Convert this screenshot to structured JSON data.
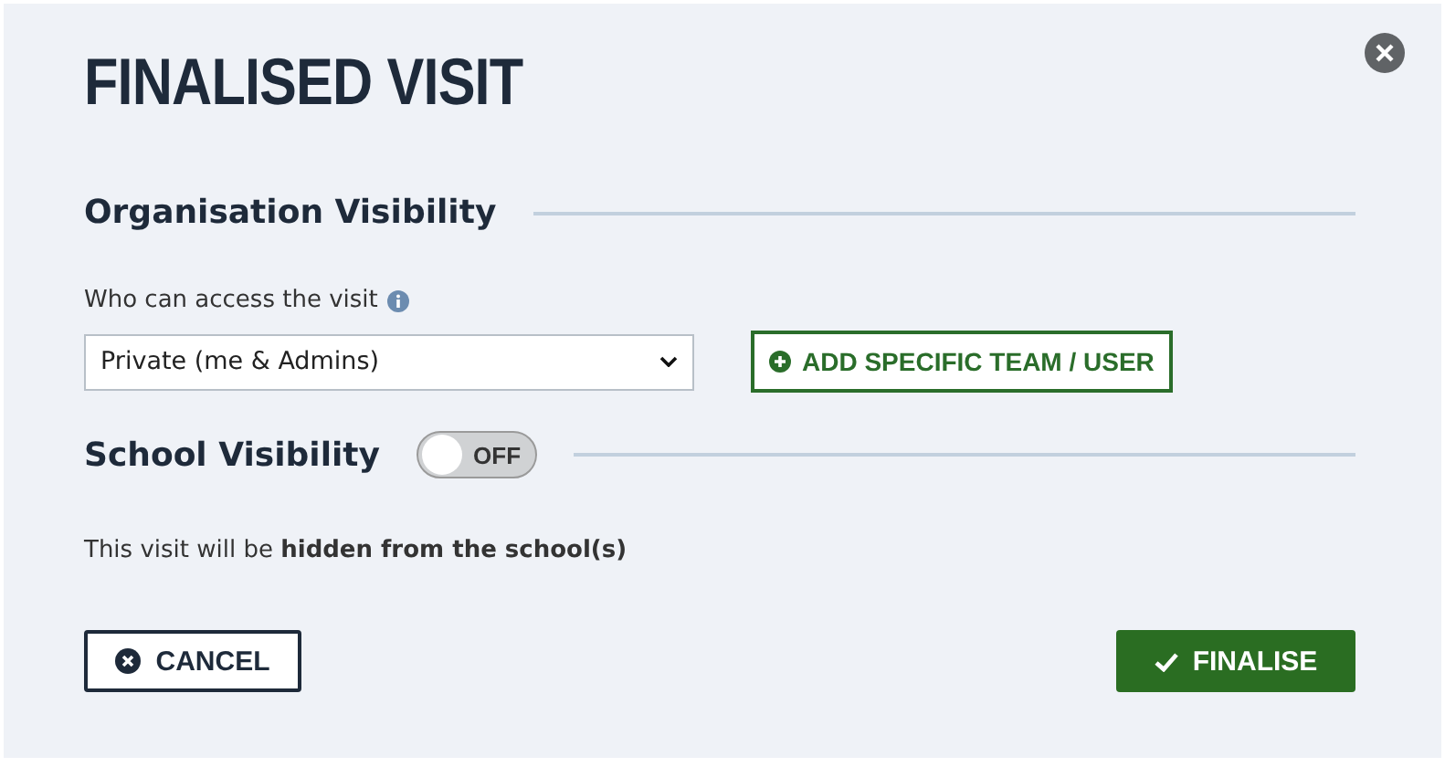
{
  "dialog": {
    "title": "FINALISED VISIT"
  },
  "organisation_visibility": {
    "heading": "Organisation Visibility",
    "field_label": "Who can access the visit",
    "select_value": "Private (me & Admins)",
    "add_button": "ADD SPECIFIC TEAM / USER"
  },
  "school_visibility": {
    "heading": "School Visibility",
    "toggle": {
      "on": false,
      "label": "OFF"
    },
    "note": "This visit will be **hidden from the school(s)**"
  },
  "buttons": [
    {
      "kind": "cancel",
      "label": "CANCEL"
    },
    {
      "kind": "finalise",
      "label": "FINALISE"
    }
  ]
}
